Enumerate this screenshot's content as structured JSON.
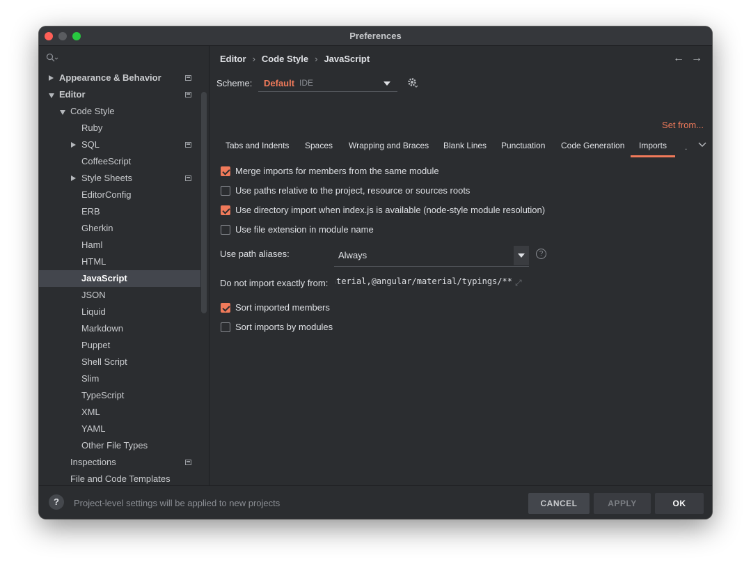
{
  "window": {
    "title": "Preferences"
  },
  "sidebar": {
    "items": [
      {
        "label": "Appearance & Behavior",
        "level": 0,
        "arrow": "right",
        "bold": true,
        "project_icon": true
      },
      {
        "label": "Editor",
        "level": 0,
        "arrow": "down",
        "bold": true,
        "project_icon": true
      },
      {
        "label": "Code Style",
        "level": 1,
        "arrow": "down"
      },
      {
        "label": "Ruby",
        "level": 2
      },
      {
        "label": "SQL",
        "level": 2,
        "arrow": "right",
        "project_icon": true
      },
      {
        "label": "CoffeeScript",
        "level": 2
      },
      {
        "label": "Style Sheets",
        "level": 2,
        "arrow": "right",
        "project_icon": true
      },
      {
        "label": "EditorConfig",
        "level": 2
      },
      {
        "label": "ERB",
        "level": 2
      },
      {
        "label": "Gherkin",
        "level": 2
      },
      {
        "label": "Haml",
        "level": 2
      },
      {
        "label": "HTML",
        "level": 2
      },
      {
        "label": "JavaScript",
        "level": 2,
        "selected": true
      },
      {
        "label": "JSON",
        "level": 2
      },
      {
        "label": "Liquid",
        "level": 2
      },
      {
        "label": "Markdown",
        "level": 2
      },
      {
        "label": "Puppet",
        "level": 2
      },
      {
        "label": "Shell Script",
        "level": 2
      },
      {
        "label": "Slim",
        "level": 2
      },
      {
        "label": "TypeScript",
        "level": 2
      },
      {
        "label": "XML",
        "level": 2
      },
      {
        "label": "YAML",
        "level": 2
      },
      {
        "label": "Other File Types",
        "level": 2
      },
      {
        "label": "Inspections",
        "level": 1,
        "project_icon": true
      },
      {
        "label": "File and Code Templates",
        "level": 1
      }
    ]
  },
  "breadcrumb": [
    "Editor",
    "Code Style",
    "JavaScript"
  ],
  "scheme": {
    "label": "Scheme:",
    "value": "Default",
    "sub": "IDE"
  },
  "set_from": "Set from...",
  "tabs": [
    {
      "label": "Tabs and Indents"
    },
    {
      "label": "Spaces"
    },
    {
      "label": "Wrapping and Braces"
    },
    {
      "label": "Blank Lines"
    },
    {
      "label": "Punctuation"
    },
    {
      "label": "Code Generation"
    },
    {
      "label": "Imports",
      "active": true
    }
  ],
  "options": [
    {
      "label": "Merge imports for members from the same module",
      "checked": true
    },
    {
      "label": "Use paths relative to the project, resource or sources roots",
      "checked": false
    },
    {
      "label": "Use directory import when index.js is available (node-style module resolution)",
      "checked": true
    },
    {
      "label": "Use file extension in module name",
      "checked": false
    }
  ],
  "path_aliases": {
    "label": "Use path aliases:",
    "value": "Always"
  },
  "exclude": {
    "label": "Do not import exactly from:",
    "value": "aterial,@angular/material/typings/**"
  },
  "sort_options": [
    {
      "label": "Sort imported members",
      "checked": true
    },
    {
      "label": "Sort imports by modules",
      "checked": false
    }
  ],
  "footer": {
    "help": "?",
    "message": "Project-level settings will be applied to new projects",
    "cancel": "CANCEL",
    "apply": "APPLY",
    "ok": "OK"
  },
  "colors": {
    "accent": "#f07a5a",
    "background": "#2b2d30",
    "selected": "#43464d"
  }
}
